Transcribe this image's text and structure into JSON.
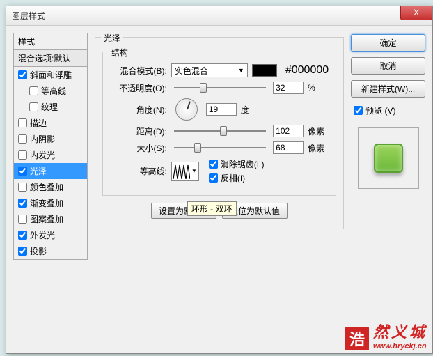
{
  "title": "图层样式",
  "close": "X",
  "left": {
    "header": "样式",
    "sub": "混合选项:默认",
    "items": [
      {
        "label": "斜面和浮雕",
        "checked": true,
        "indent": false,
        "selected": false
      },
      {
        "label": "等高线",
        "checked": false,
        "indent": true,
        "selected": false
      },
      {
        "label": "纹理",
        "checked": false,
        "indent": true,
        "selected": false
      },
      {
        "label": "描边",
        "checked": false,
        "indent": false,
        "selected": false
      },
      {
        "label": "内阴影",
        "checked": false,
        "indent": false,
        "selected": false
      },
      {
        "label": "内发光",
        "checked": false,
        "indent": false,
        "selected": false
      },
      {
        "label": "光泽",
        "checked": true,
        "indent": false,
        "selected": true
      },
      {
        "label": "颜色叠加",
        "checked": false,
        "indent": false,
        "selected": false
      },
      {
        "label": "渐变叠加",
        "checked": true,
        "indent": false,
        "selected": false
      },
      {
        "label": "图案叠加",
        "checked": false,
        "indent": false,
        "selected": false
      },
      {
        "label": "外发光",
        "checked": true,
        "indent": false,
        "selected": false
      },
      {
        "label": "投影",
        "checked": true,
        "indent": false,
        "selected": false
      }
    ]
  },
  "center": {
    "group_title": "光泽",
    "struct_title": "结构",
    "blend_mode_label": "混合模式(B):",
    "blend_mode_value": "实色混合",
    "color_hex": "#000000",
    "opacity_label": "不透明度(O):",
    "opacity_value": "32",
    "opacity_unit": "%",
    "angle_label": "角度(N):",
    "angle_value": "19",
    "angle_unit": "度",
    "distance_label": "距离(D):",
    "distance_value": "102",
    "distance_unit": "像素",
    "size_label": "大小(S):",
    "size_value": "68",
    "size_unit": "像素",
    "contour_label": "等高线:",
    "antialias_label": "消除锯齿(L)",
    "invert_label": "反相(I)",
    "btn_default": "设置为默认值",
    "btn_reset": "复位为默认值",
    "tooltip": "环形 - 双环"
  },
  "right": {
    "ok": "确定",
    "cancel": "取消",
    "newstyle": "新建样式(W)...",
    "preview_label": "预览 (V)"
  },
  "watermark": {
    "badge": "浩",
    "text": "然义城",
    "url": "www.hryckj.cn"
  }
}
